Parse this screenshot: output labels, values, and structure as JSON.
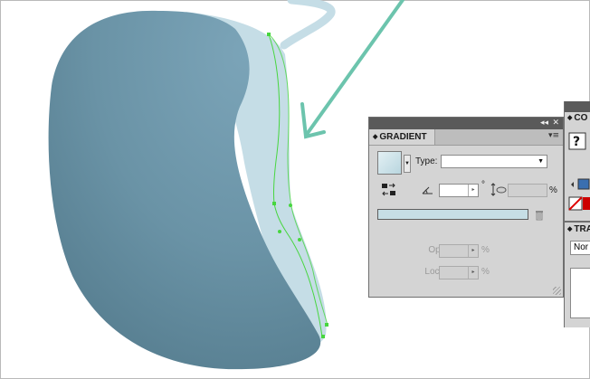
{
  "gradient_panel": {
    "tab_label": "GRADIENT",
    "type_label": "Type:",
    "type_value": "",
    "angle_value": "",
    "degree_symbol": "°",
    "aspect_value": "",
    "percent_symbol": "%",
    "opacity_label": "Opacity:",
    "opacity_value": "",
    "location_label": "Location:",
    "location_value": "",
    "gradient_color": "#c6dee5"
  },
  "right_panels": {
    "color_tab_partial": "CO",
    "transparency_tab_partial": "TRA",
    "blend_mode_partial": "Nor"
  },
  "artwork": {
    "bean_dark_color": "#6a93a6",
    "highlight_color": "#c5dde6",
    "arrow_color": "#6cc4ad",
    "path_color": "#47d63f"
  }
}
